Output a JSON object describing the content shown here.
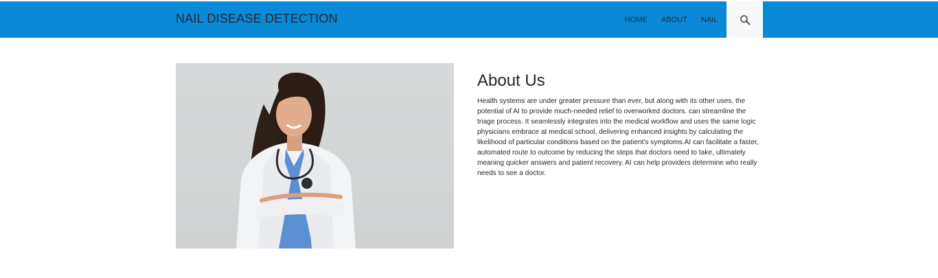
{
  "header": {
    "brand": "NAIL DISEASE DETECTION",
    "nav": [
      {
        "label": "HOME"
      },
      {
        "label": "ABOUT"
      },
      {
        "label": "NAIL"
      }
    ],
    "search_icon": "search-icon"
  },
  "about": {
    "heading": "About Us",
    "body": "Health systems are under greater pressure than ever, but along with its other uses, the potential of AI to provide much-needed relief to overworked doctors. can streamline the triage process. It seamlessly integrates into the medical workflow and uses the same logic physicians embrace at medical school, delivering enhanced insights by calculating the likelihood of particular conditions based on the patient's symptoms.AI can facilitate a faster, automated route to outcome by reducing the steps that doctors need to take, ultimately meaning quicker answers and patient recovery. AI can help providers determine who really needs to see a doctor."
  },
  "colors": {
    "navbar": "#0989d6",
    "search_bg": "#f6f8fa",
    "text": "#1f2a36"
  }
}
